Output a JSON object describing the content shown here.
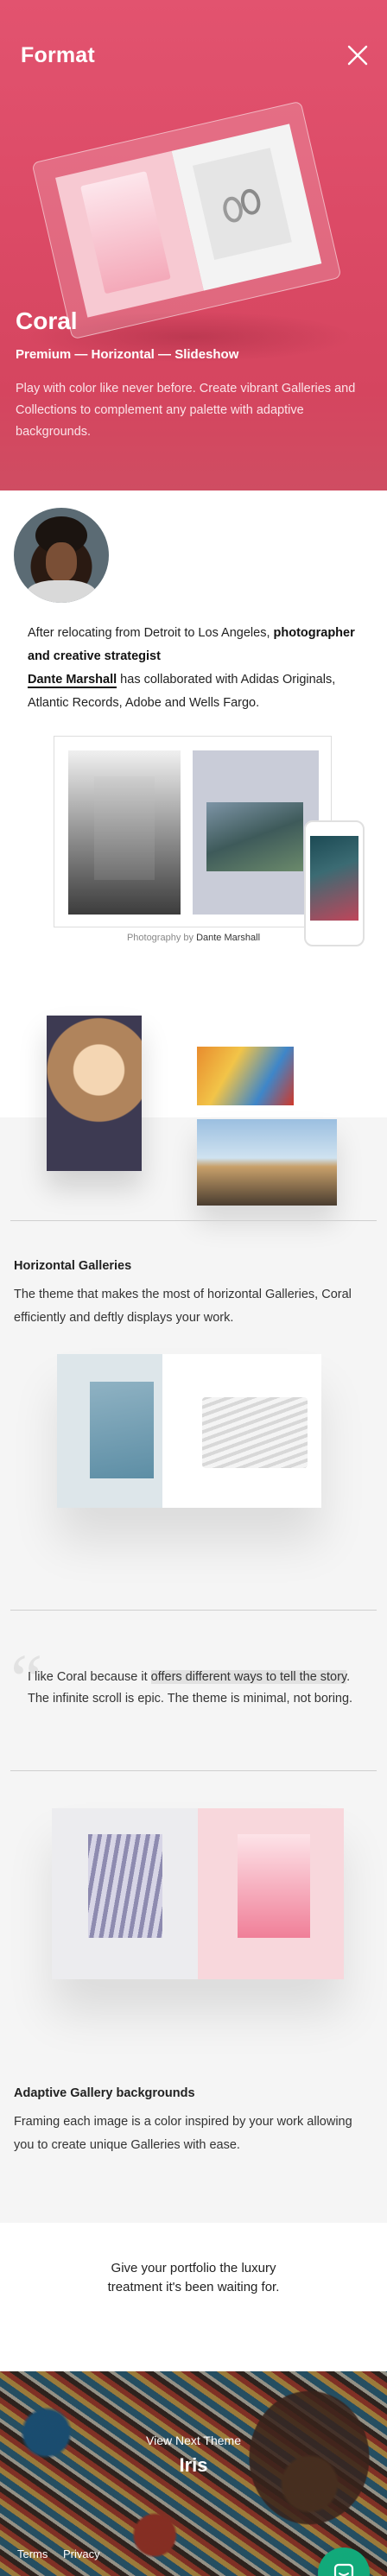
{
  "header": {
    "brand": "Format",
    "close_icon": "close-icon"
  },
  "hero": {
    "title": "Coral",
    "subtitle": "Premium — Horizontal — Slideshow",
    "description": "Play with color like never before. Create vibrant Galleries and Collections to complement any palette with adaptive backgrounds.",
    "accent": "#dc4a66"
  },
  "bio": {
    "text_1": "After relocating from Detroit to Los Angeles, ",
    "role": "photographer and creative strategist",
    "name": "Dante Marshall",
    "text_2": " has collaborated with Adidas Originals, Atlantic Records, Adobe and Wells Fargo."
  },
  "photo_credit": {
    "prefix": "Photography by ",
    "name": "Dante Marshall"
  },
  "horizontal": {
    "title": "Horizontal Galleries",
    "text": "The theme that makes the most of horizontal Galleries, Coral efficiently and deftly displays your work."
  },
  "quote": {
    "before": "I like Coral because it ",
    "highlight": "offers different ways to tell the story",
    "after": ". The infinite scroll is epic. The theme is minimal, not boring."
  },
  "adaptive": {
    "title": "Adaptive Gallery backgrounds",
    "text": "Framing each image is a color inspired by your work allowing you to create unique Galleries with ease."
  },
  "cta": {
    "text": "Give your portfolio the luxury treatment it's been waiting for."
  },
  "next_theme": {
    "label": "View Next Theme",
    "name": "Iris"
  },
  "footer": {
    "terms": "Terms",
    "privacy": "Privacy"
  },
  "chat": {
    "icon": "chat-icon",
    "color": "#12a97a"
  }
}
